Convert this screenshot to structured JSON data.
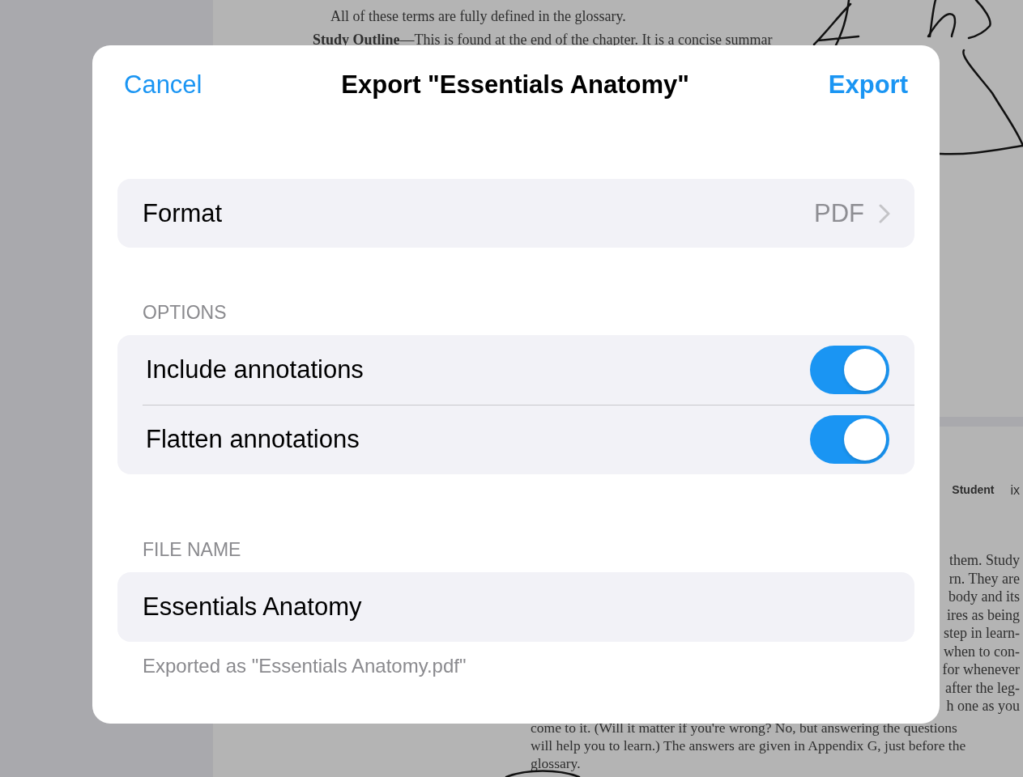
{
  "document": {
    "top_lines": [
      "All of these terms are fully defined in the glossary.",
      "**Study Outline**—This is found at the end of the chapter. It is a concise summar"
    ],
    "running_head": {
      "title": "Student",
      "page": "ix"
    },
    "right_lines": [
      "them. Study",
      "rn. They are",
      "body and its",
      "ires as being",
      "step in learn-",
      "when to con-",
      "for whenever",
      "after the leg-",
      "h one as you"
    ],
    "bottom_lines": [
      "come to it. (Will it matter if you're wrong? No, but answering the questions",
      "will help you to learn.) The answers are given in Appendix G, just before the",
      "glossary."
    ]
  },
  "dialog": {
    "cancel": "Cancel",
    "title": "Export \"Essentials Anatomy\"",
    "confirm": "Export",
    "format": {
      "label": "Format",
      "value": "PDF"
    },
    "options_header": "OPTIONS",
    "options": [
      {
        "label": "Include annotations",
        "on": true
      },
      {
        "label": "Flatten annotations",
        "on": true
      }
    ],
    "file_name_header": "FILE NAME",
    "file_name": {
      "value": "Essentials Anatomy"
    },
    "file_name_note": "Exported as \"Essentials Anatomy.pdf\""
  }
}
